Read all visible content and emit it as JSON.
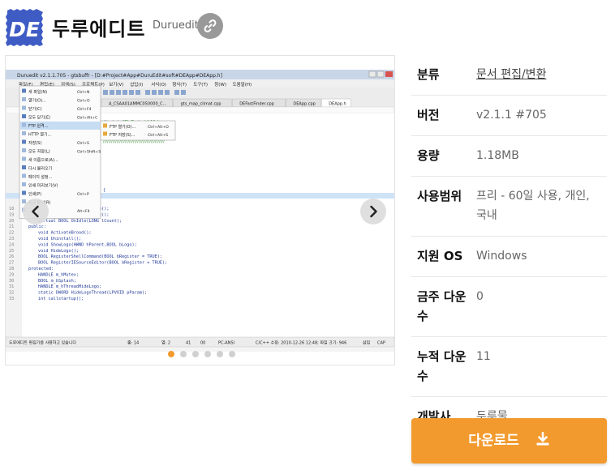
{
  "app": {
    "title": "두루에디트",
    "subtitle": "Duruedit",
    "logo_text": "DE",
    "link_icon": "link-icon"
  },
  "gallery": {
    "dots": 6,
    "active_index": 0,
    "prev_icon": "chevron-left-icon",
    "next_icon": "chevron-right-icon",
    "screenshot": {
      "title": "Duruedit v2.1.1.705 - gtsbuffr - [D:#Project#App#DuruEdit#soft#DEApp#DEApp.h]",
      "menubar": [
        "파일(F)",
        "편집(E)",
        "검색(S)",
        "프로젝트(P)",
        "보기(V)",
        "삽입(I)",
        "서식(O)",
        "형식(T)",
        "도구(T)",
        "창(W)",
        "도움말(H)"
      ],
      "tabs": [
        "A_CSAA01AMMC050000_C...",
        "gts_map_climat.cpp",
        "DEFastFinder.cpp",
        "DEApp.cpp",
        "DEApp.h"
      ],
      "file_menu": [
        {
          "label": "새 파일(N)",
          "shortcut": "Ctrl+N"
        },
        {
          "label": "열기(O)...",
          "shortcut": "Ctrl+O"
        },
        {
          "label": "닫기(C)",
          "shortcut": "Ctrl+F4"
        },
        {
          "label": "모두 닫기(E)",
          "shortcut": "Ctrl+Alt+C"
        },
        {
          "label": "FTP 원격...",
          "shortcut": ""
        },
        {
          "label": "HTTP 열기...",
          "shortcut": ""
        },
        {
          "label": "저장(S)",
          "shortcut": "Ctrl+S"
        },
        {
          "label": "모두 저장(L)",
          "shortcut": "Ctrl+Shift+S"
        },
        {
          "label": "새 이름으로(A)...",
          "shortcut": ""
        },
        {
          "label": "다시 불러오기",
          "shortcut": ""
        },
        {
          "label": "페이지 설정...",
          "shortcut": ""
        },
        {
          "label": "인쇄 미리보기(V)",
          "shortcut": ""
        },
        {
          "label": "인쇄(P)",
          "shortcut": "Ctrl+P"
        },
        {
          "label": "최근 문서(R)",
          "shortcut": ""
        },
        {
          "label": "",
          "shortcut": "Alt+F4"
        }
      ],
      "ftp_submenu": [
        {
          "label": "FTP 열기(O)...",
          "shortcut": "Ctrl+Alt+O"
        },
        {
          "label": "FTP 저장(S)...",
          "shortcut": "Ctrl+Alt+S"
        }
      ],
      "code_lines": [
        "virtual BOOL InitInstance();",
        "virtual BOOL ExitInstance();",
        "virtual BOOL OnIdle(LONG lCount);",
        "public:",
        "void ActivateBrood();",
        "void Uninstall();",
        "void ShowLogo(HWND hParent,BOOL bLogo);",
        "void HideLogo();",
        "BOOL RegisterShellCommand(BOOL bRegister = TRUE);",
        "BOOL RegisterIESourceEditor(BOOL bRegister = TRUE);",
        "protected:",
        "HANDLE m_hMutex;",
        "BOOL m_bSplash;",
        "HANDLE m_hThreadHideLogo;",
        "static DWORD HideLogoThread(LPVOID pParam);",
        "int callstartup();"
      ],
      "status": [
        "두루에디트 편집기를 사용하고 있습니다",
        "줄: 14",
        "열: 2",
        "41",
        "00",
        "PC-ANSI",
        "C/C++ 수정: 2010-12-26 12:48; 파일 크기: 946",
        "삽입",
        "CAP"
      ]
    }
  },
  "info": {
    "rows": [
      {
        "label": "분류",
        "value": "문서 편집/변환",
        "link": true
      },
      {
        "label": "버전",
        "value": "v2.1.1 #705",
        "link": false
      },
      {
        "label": "용량",
        "value": "1.18MB",
        "link": false
      },
      {
        "label": "사용범위",
        "value": "프리 - 60일 사용, 개인, 국내",
        "link": false
      },
      {
        "label": "지원 OS",
        "value": "Windows",
        "link": false
      },
      {
        "label": "금주 다운수",
        "value": "0",
        "link": false
      },
      {
        "label": "누적 다운수",
        "value": "11",
        "link": false
      },
      {
        "label": "개발사",
        "value": "두루물",
        "link": false
      }
    ]
  },
  "download": {
    "label": "다운로드",
    "icon": "download-icon",
    "color": "#f29a2e"
  }
}
